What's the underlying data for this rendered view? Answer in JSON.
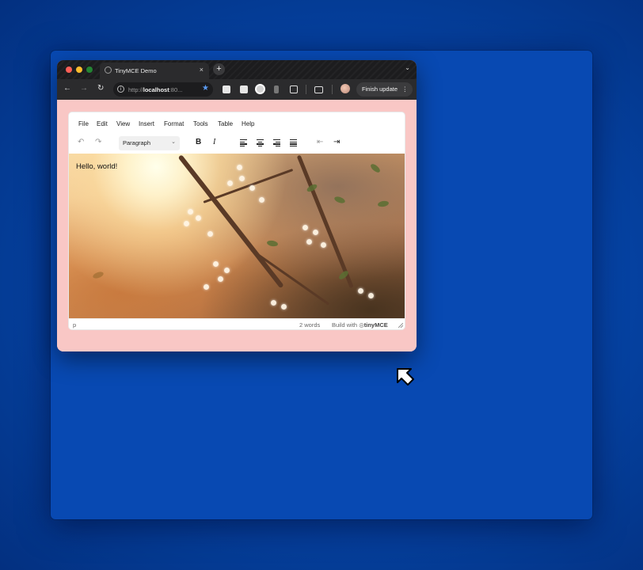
{
  "browser": {
    "tab": {
      "title": "TinyMCE Demo",
      "close": "×"
    },
    "new_tab": "+",
    "tab_menu": "⌄",
    "nav": {
      "back": "←",
      "forward": "→",
      "reload": "↻"
    },
    "address": {
      "prefix": "http://",
      "host": "localhost",
      "suffix": ":80..."
    },
    "bookmark": "★",
    "finish_update": "Finish update",
    "more": "⋮"
  },
  "editor": {
    "menu": [
      "File",
      "Edit",
      "View",
      "Insert",
      "Format",
      "Tools",
      "Table",
      "Help"
    ],
    "toolbar": {
      "undo": "↶",
      "redo": "↷",
      "blocks": "Paragraph",
      "blocks_chevron": "⌄",
      "bold": "B",
      "italic": "I",
      "outdent": "⇤",
      "indent": "⇥"
    },
    "content_text": "Hello, world!",
    "status": {
      "path": "p",
      "word_count": "2 words",
      "build_prefix": "Build with",
      "brand": "tinyMCE"
    }
  }
}
